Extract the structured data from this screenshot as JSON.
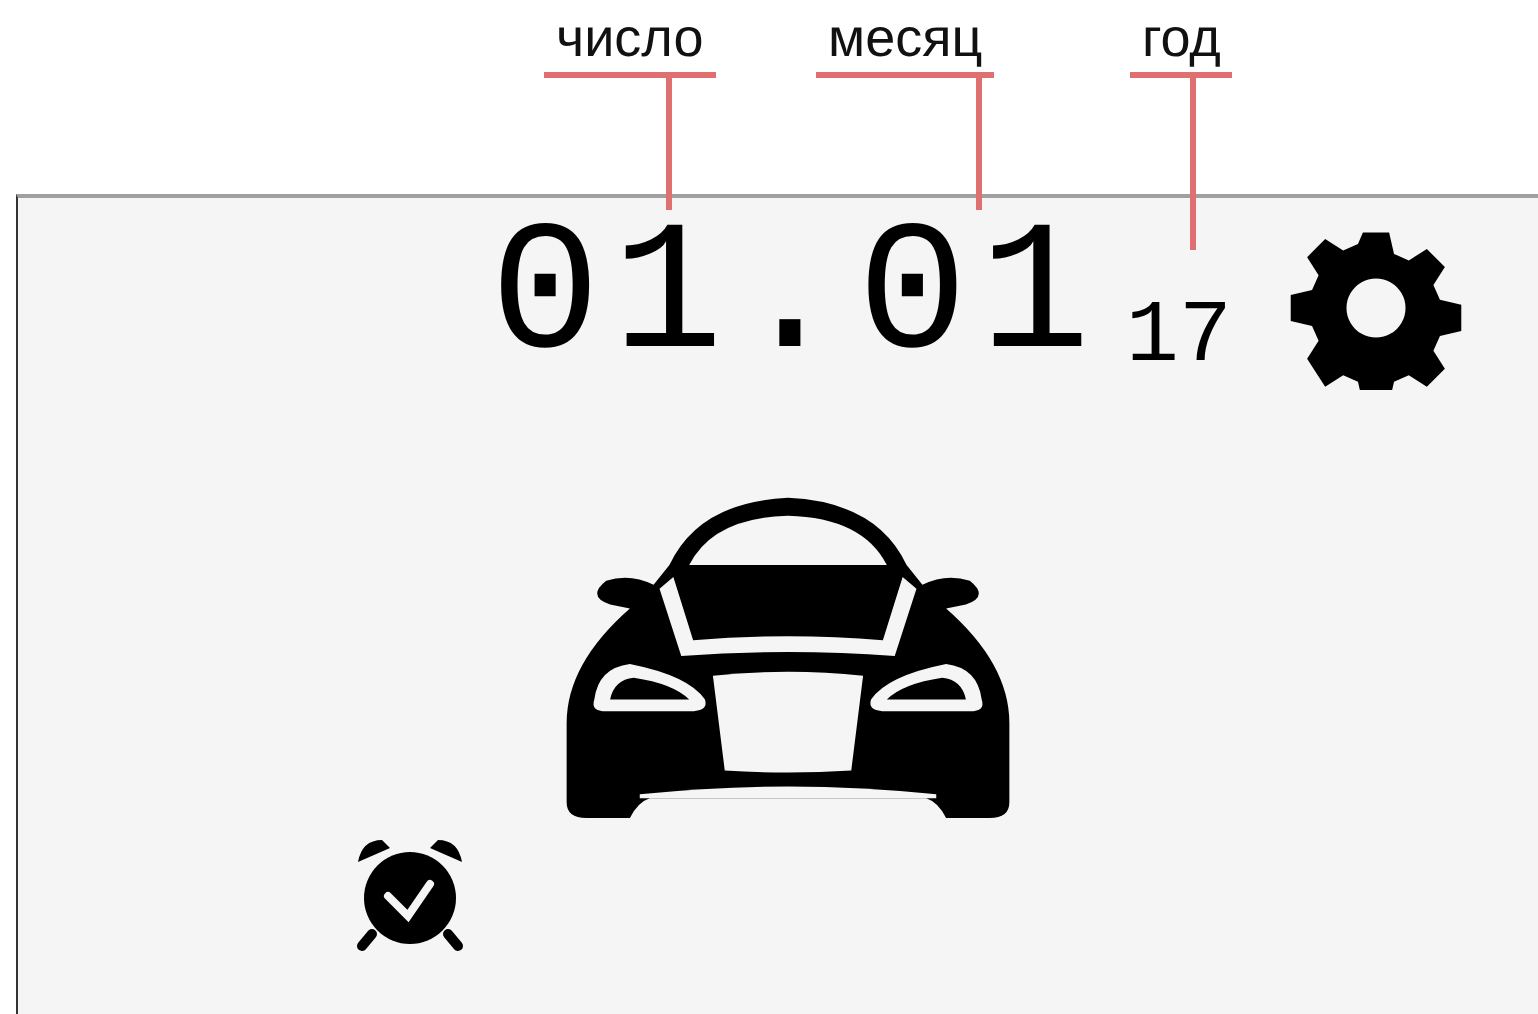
{
  "annotations": [
    {
      "label": "число"
    },
    {
      "label": "месяц"
    },
    {
      "label": "год"
    }
  ],
  "display": {
    "date": "01.01",
    "year": "17"
  }
}
